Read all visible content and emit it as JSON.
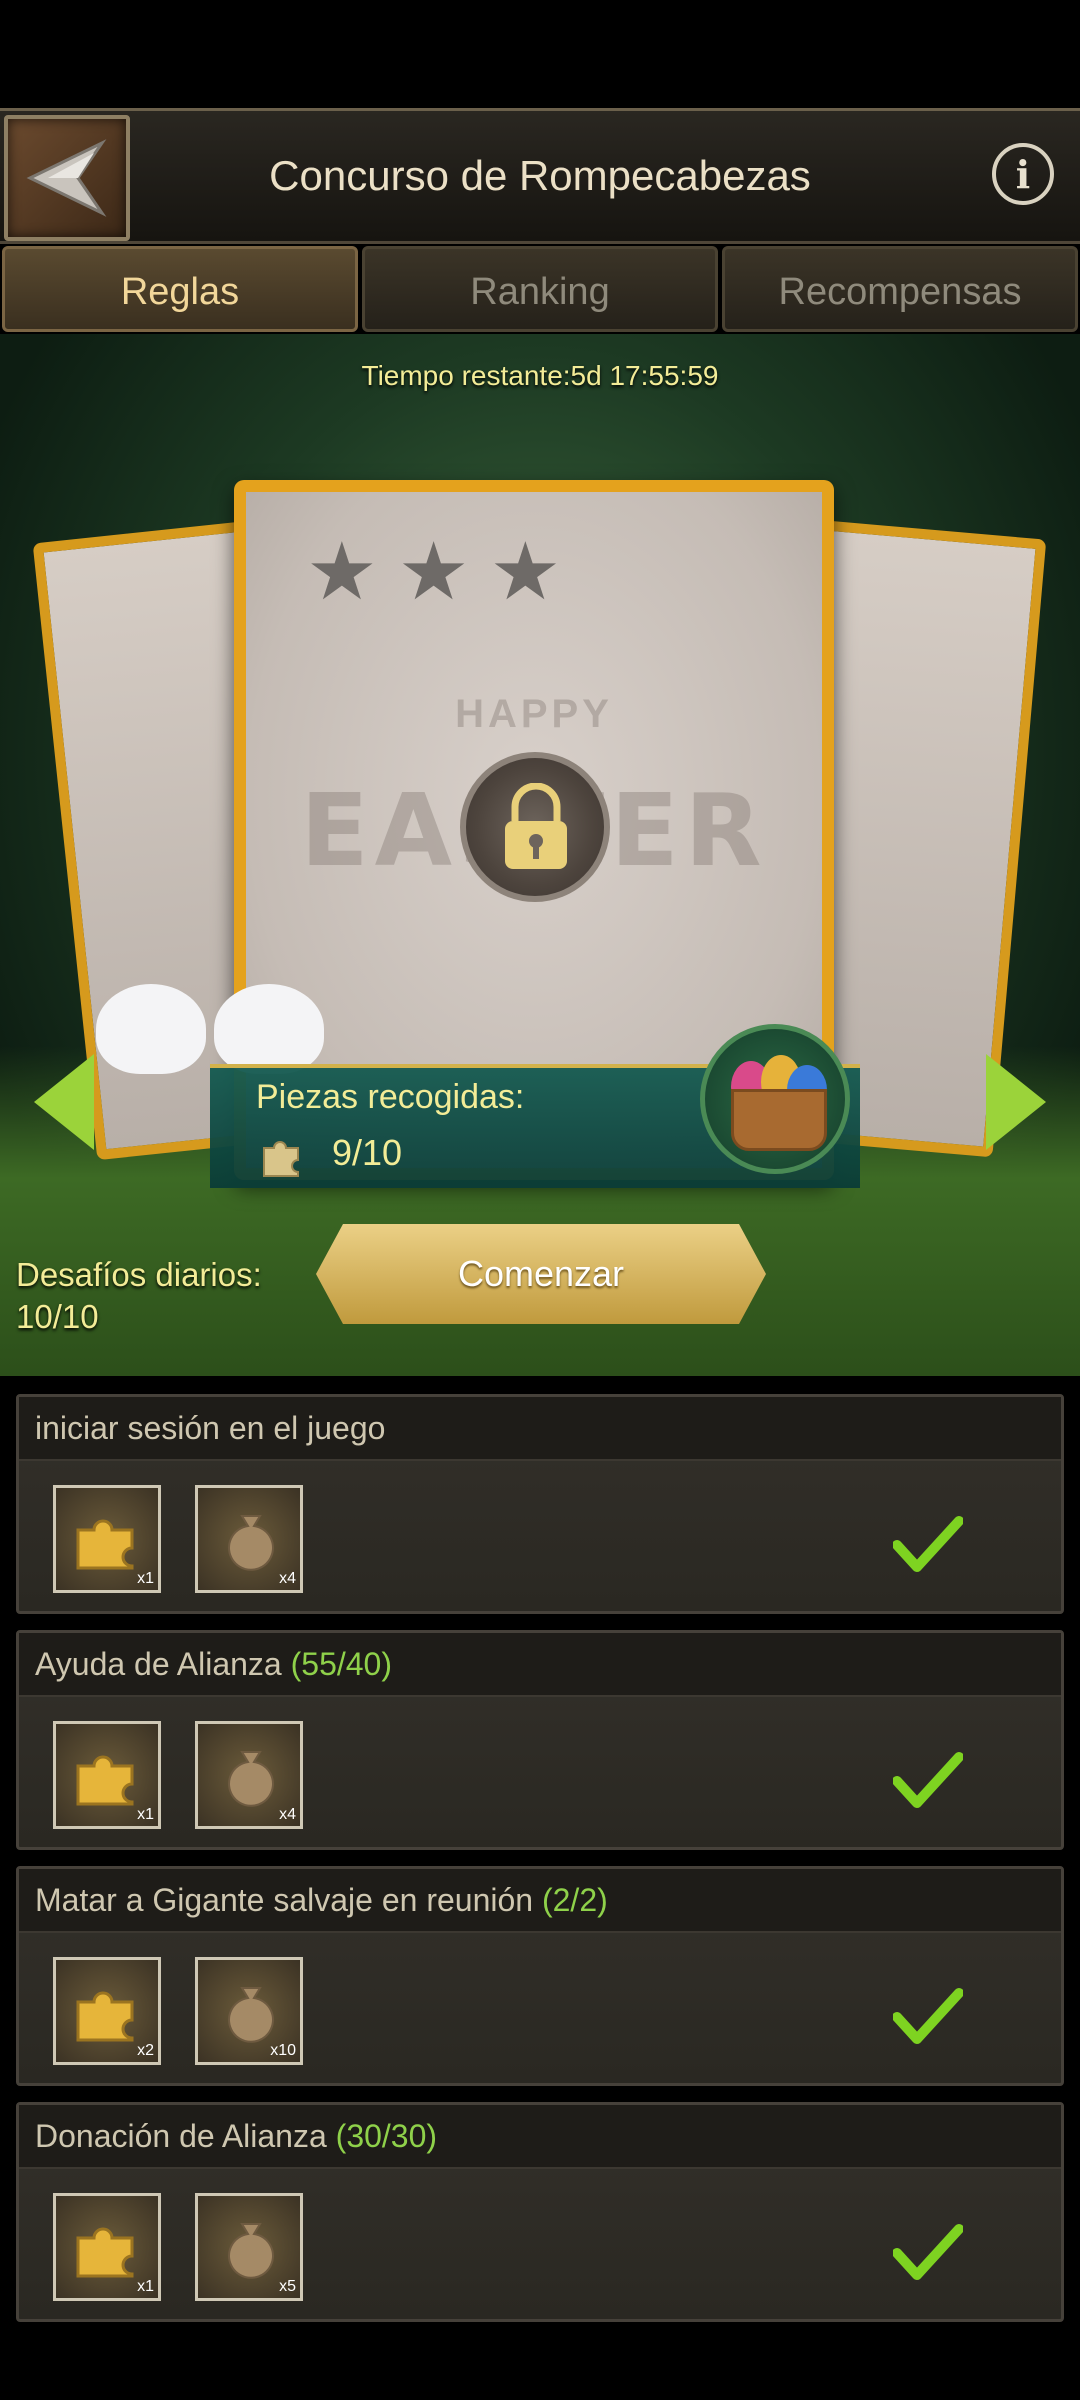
{
  "header": {
    "title": "Concurso de Rompecabezas",
    "back_icon": "back-arrow-icon",
    "info_icon": "info-icon",
    "info_glyph": "i"
  },
  "tabs": [
    {
      "label": "Reglas",
      "active": true
    },
    {
      "label": "Ranking",
      "active": false
    },
    {
      "label": "Recompensas",
      "active": false
    }
  ],
  "hero": {
    "timer": "Tiempo restante:5d 17:55:59",
    "card_text_top": "HAPPY",
    "card_text_main": "EASTER",
    "stars_filled": 0,
    "stars_total": 3,
    "pieces_label": "Piezas recogidas:",
    "pieces_count": "9/10",
    "daily_label": "Desafíos diarios:",
    "daily_count": "10/10",
    "start_button": "Comenzar"
  },
  "tasks": [
    {
      "name": "iniciar sesión en el juego",
      "progress": "",
      "rewards": [
        {
          "icon": "puzzle-piece-icon",
          "qty": "x1"
        },
        {
          "icon": "resource-bag-icon",
          "qty": "x4"
        }
      ],
      "completed": true
    },
    {
      "name": "Ayuda de Alianza ",
      "progress": "(55/40)",
      "rewards": [
        {
          "icon": "puzzle-piece-icon",
          "qty": "x1"
        },
        {
          "icon": "resource-bag-icon",
          "qty": "x4"
        }
      ],
      "completed": true
    },
    {
      "name": "Matar a Gigante salvaje en reunión ",
      "progress": "(2/2)",
      "rewards": [
        {
          "icon": "puzzle-piece-icon",
          "qty": "x2"
        },
        {
          "icon": "resource-bag-icon",
          "qty": "x10"
        }
      ],
      "completed": true
    },
    {
      "name": "Donación de Alianza ",
      "progress": "(30/30)",
      "rewards": [
        {
          "icon": "puzzle-piece-icon",
          "qty": "x1"
        },
        {
          "icon": "resource-bag-icon",
          "qty": "x5"
        }
      ],
      "completed": true
    }
  ],
  "colors": {
    "accent_gold": "#f3ec97",
    "progress_green": "#8fd14a",
    "check_green": "#7ed321",
    "card_border": "#e4a21d"
  }
}
